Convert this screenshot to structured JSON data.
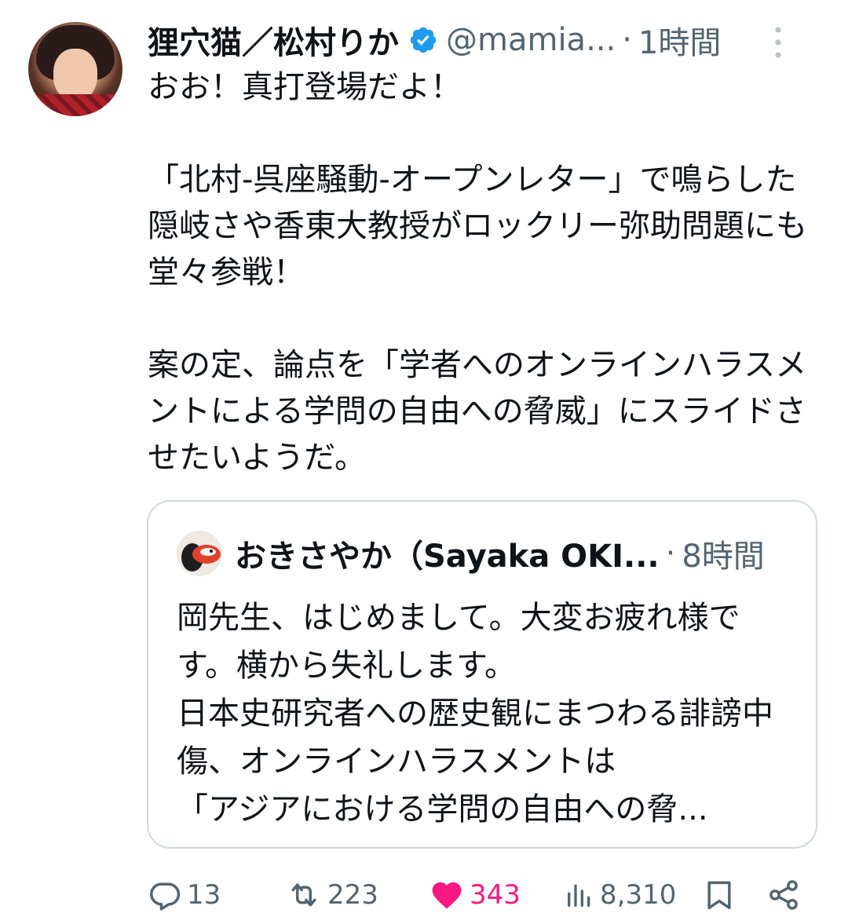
{
  "post": {
    "author": {
      "display_name": "狸穴猫／松村りか",
      "handle": "@mamia...",
      "separator": "·",
      "time": "1時間"
    },
    "text": "おお！真打登場だよ！\n\n「北村-呉座騒動-オープンレター」で鳴らした隠岐さや香東大教授がロックリー弥助問題にも堂々参戦！\n\n案の定、論点を「学者へのオンラインハラスメントによる学問の自由への脅威」にスライドさせたいようだ。",
    "quote": {
      "display_name": "おきさやか（Sayaka OKI...",
      "separator": "·",
      "time": "8時間",
      "text": "岡先生、はじめまして。大変お疲れ様です。横から失礼します。\n日本史研究者への歴史観にまつわる誹謗中傷、オンラインハラスメントは\n「アジアにおける学問の自由への脅..."
    },
    "actions": {
      "reply_count": "13",
      "repost_count": "223",
      "like_count": "343",
      "view_count": "8,310"
    }
  },
  "colors": {
    "text_primary": "#0f1419",
    "text_secondary": "#536471",
    "verified_blue": "#1d9bf0",
    "like_pink": "#f91880",
    "border": "#cfd9de"
  },
  "icons": {
    "verified": "verified-badge-icon",
    "more": "more-vertical-icon",
    "reply": "reply-icon",
    "repost": "repost-icon",
    "like": "heart-filled-icon",
    "views": "views-chart-icon",
    "bookmark": "bookmark-icon",
    "share": "share-icon"
  }
}
